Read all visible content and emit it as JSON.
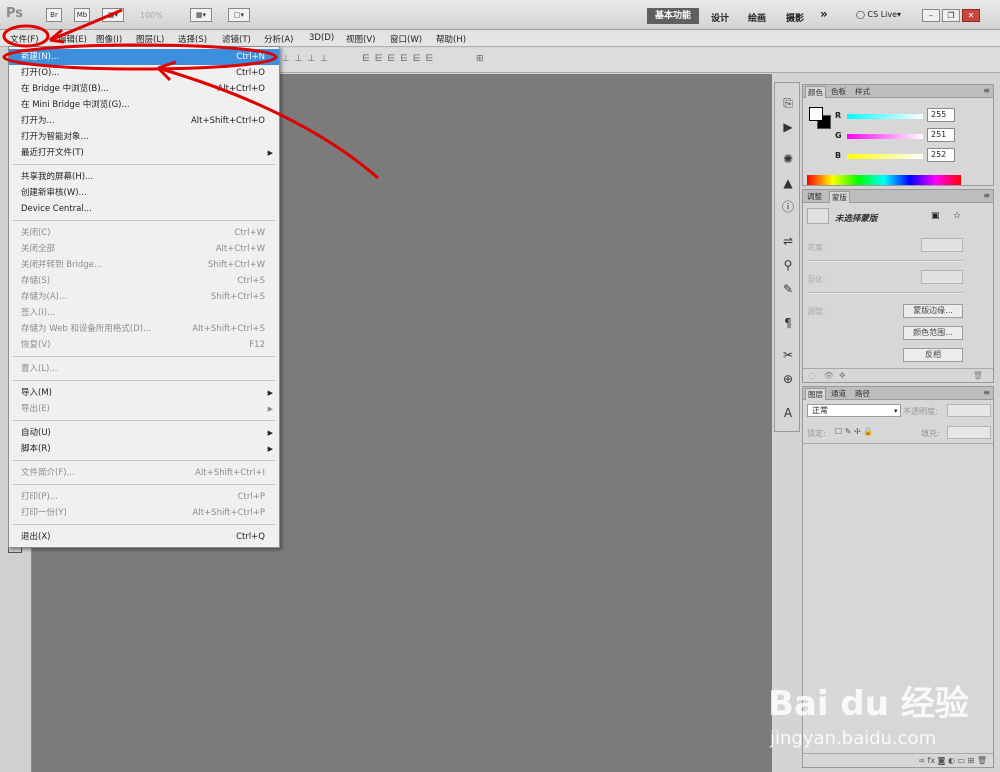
{
  "app": {
    "logo": "Ps",
    "bridge_btn": "Br",
    "minibridge_btn": "Mb",
    "zoom": "100%",
    "workspaces": {
      "active": "基本功能",
      "design": "设计",
      "painting": "绘画",
      "photography": "摄影",
      "more": "»"
    },
    "cslive": "CS Live"
  },
  "menubar": [
    "文件(F)",
    "编辑(E)",
    "图像(I)",
    "图层(L)",
    "选择(S)",
    "滤镜(T)",
    "分析(A)",
    "3D(D)",
    "视图(V)",
    "窗口(W)",
    "帮助(H)"
  ],
  "file_menu": {
    "items": [
      {
        "label": "新建(N)...",
        "shortcut": "Ctrl+N",
        "state": "highlighted"
      },
      {
        "label": "打开(O)...",
        "shortcut": "Ctrl+O",
        "state": "enabled"
      },
      {
        "label": "在 Bridge 中浏览(B)...",
        "shortcut": "Alt+Ctrl+O",
        "state": "enabled"
      },
      {
        "label": "在 Mini Bridge 中浏览(G)...",
        "shortcut": "",
        "state": "enabled"
      },
      {
        "label": "打开为...",
        "shortcut": "Alt+Shift+Ctrl+O",
        "state": "enabled"
      },
      {
        "label": "打开为智能对象...",
        "shortcut": "",
        "state": "enabled"
      },
      {
        "label": "最近打开文件(T)",
        "shortcut": "",
        "state": "enabled",
        "submenu": true
      },
      {
        "label": "共享我的屏幕(H)...",
        "shortcut": "",
        "state": "enabled"
      },
      {
        "label": "创建新审核(W)...",
        "shortcut": "",
        "state": "enabled"
      },
      {
        "label": "Device Central...",
        "shortcut": "",
        "state": "enabled"
      },
      {
        "label": "关闭(C)",
        "shortcut": "Ctrl+W",
        "state": "disabled"
      },
      {
        "label": "关闭全部",
        "shortcut": "Alt+Ctrl+W",
        "state": "disabled"
      },
      {
        "label": "关闭并转到 Bridge...",
        "shortcut": "Shift+Ctrl+W",
        "state": "disabled"
      },
      {
        "label": "存储(S)",
        "shortcut": "Ctrl+S",
        "state": "disabled"
      },
      {
        "label": "存储为(A)...",
        "shortcut": "Shift+Ctrl+S",
        "state": "disabled"
      },
      {
        "label": "签入(I)...",
        "shortcut": "",
        "state": "disabled"
      },
      {
        "label": "存储为 Web 和设备所用格式(D)...",
        "shortcut": "Alt+Shift+Ctrl+S",
        "state": "disabled"
      },
      {
        "label": "恢复(V)",
        "shortcut": "F12",
        "state": "disabled"
      },
      {
        "label": "置入(L)...",
        "shortcut": "",
        "state": "disabled"
      },
      {
        "label": "导入(M)",
        "shortcut": "",
        "state": "enabled",
        "submenu": true
      },
      {
        "label": "导出(E)",
        "shortcut": "",
        "state": "disabled",
        "submenu": true
      },
      {
        "label": "自动(U)",
        "shortcut": "",
        "state": "enabled",
        "submenu": true
      },
      {
        "label": "脚本(R)",
        "shortcut": "",
        "state": "enabled",
        "submenu": true
      },
      {
        "label": "文件简介(F)...",
        "shortcut": "Alt+Shift+Ctrl+I",
        "state": "disabled"
      },
      {
        "label": "打印(P)...",
        "shortcut": "Ctrl+P",
        "state": "disabled"
      },
      {
        "label": "打印一份(Y)",
        "shortcut": "Alt+Shift+Ctrl+P",
        "state": "disabled"
      },
      {
        "label": "退出(X)",
        "shortcut": "Ctrl+Q",
        "state": "enabled"
      }
    ]
  },
  "color_panel": {
    "tabs": [
      "颜色",
      "色板",
      "样式"
    ],
    "r": "255",
    "g": "251",
    "b": "252",
    "r_label": "R",
    "g_label": "G",
    "b_label": "B"
  },
  "masks_panel": {
    "tabs": [
      "调整",
      "蒙版"
    ],
    "title": "未选择蒙版",
    "density_label": "浓度:",
    "feather_label": "羽化:",
    "refine_label": "调整:",
    "btn_edge": "蒙版边缘...",
    "btn_color_range": "颜色范围...",
    "btn_invert": "反相"
  },
  "layers_panel": {
    "tabs": [
      "图层",
      "通道",
      "路径"
    ],
    "blend_mode": "正常",
    "opacity_label": "不透明度:",
    "lock_label": "锁定:",
    "fill_label": "填充:"
  },
  "watermark": {
    "line1": "Bai du 经验",
    "line2": "jingyan.baidu.com"
  },
  "colors": {
    "highlight": "#3c8fdc",
    "annotation": "#e00000",
    "canvas": "#7b7b7b"
  }
}
